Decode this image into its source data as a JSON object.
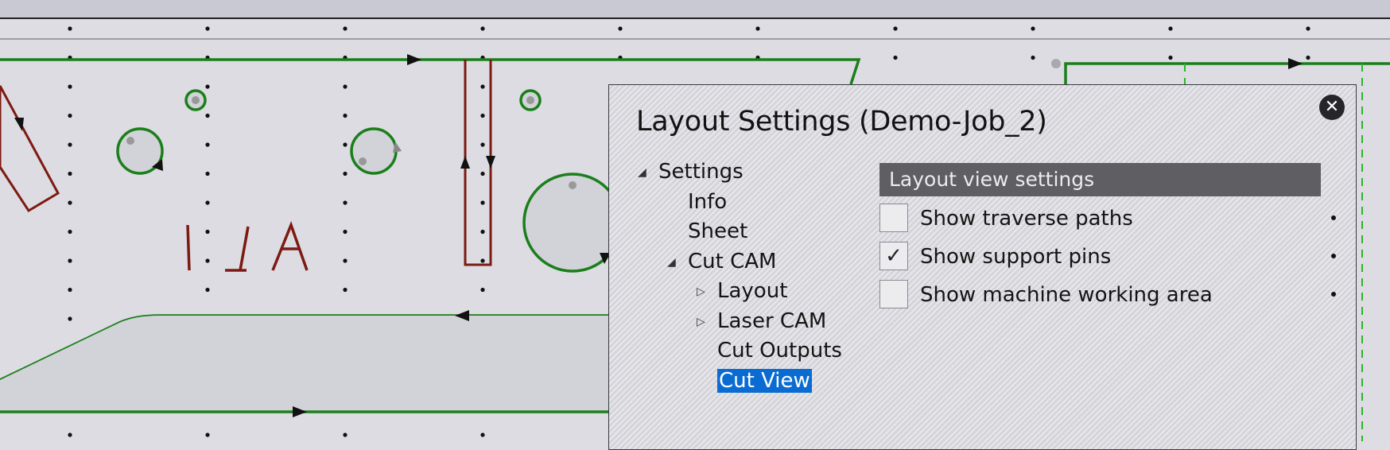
{
  "dialog": {
    "title": "Layout Settings (Demo-Job_2)",
    "close_icon": "close-icon",
    "tree": [
      {
        "label": "Settings",
        "level": 0,
        "expanded": true,
        "has_children": true,
        "selected": false
      },
      {
        "label": "Info",
        "level": 1,
        "has_children": false,
        "selected": false
      },
      {
        "label": "Sheet",
        "level": 1,
        "has_children": false,
        "selected": false
      },
      {
        "label": "Cut CAM",
        "level": 1,
        "expanded": true,
        "has_children": true,
        "selected": false
      },
      {
        "label": "Layout",
        "level": 2,
        "expanded": false,
        "has_children": true,
        "selected": false
      },
      {
        "label": "Laser CAM",
        "level": 2,
        "expanded": false,
        "has_children": true,
        "selected": false
      },
      {
        "label": "Cut Outputs",
        "level": 2,
        "has_children": false,
        "selected": false
      },
      {
        "label": "Cut View",
        "level": 2,
        "has_children": false,
        "selected": true
      }
    ],
    "section_header": "Layout view settings",
    "options": [
      {
        "label": "Show traverse paths",
        "checked": false
      },
      {
        "label": "Show support pins",
        "checked": true
      },
      {
        "label": "Show machine working area",
        "checked": false
      }
    ]
  },
  "canvas": {
    "path_label_text": "ATI",
    "colors": {
      "background": "#dddde3",
      "toolbar": "#c9c9d3",
      "cut_path": "#1a7f1a",
      "inner_cut": "#7d1a12",
      "selection": "#0a6cd2",
      "header": "#5e5e63"
    }
  }
}
